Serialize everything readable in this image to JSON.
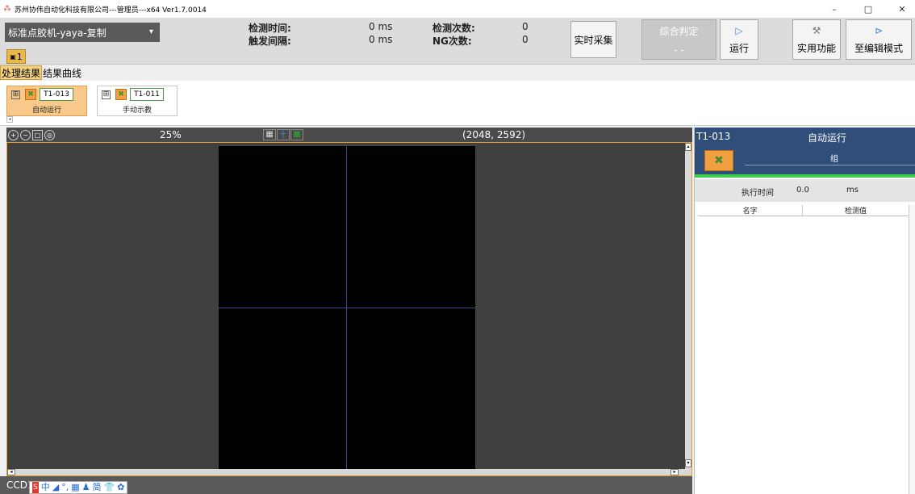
{
  "window": {
    "title": "苏州协伟自动化科技有限公司---管理员---x64 Ver1.7.0014",
    "minimize": "–",
    "maximize": "□",
    "close": "✕"
  },
  "toolbar": {
    "preset": "标准点胶机-yaya-复制",
    "camera_tab": "1",
    "stats": {
      "detect_time_label": "检测时间:",
      "detect_time_value": "0 ms",
      "trigger_interval_label": "触发间隔:",
      "trigger_interval_value": "0 ms",
      "detect_count_label": "检测次数:",
      "detect_count_value": "0",
      "ng_count_label": "NG次数:",
      "ng_count_value": "0"
    },
    "realtime_button": "实时采集",
    "judge_title": "综合判定",
    "judge_value": "- -",
    "run_button": "运行",
    "utility_button": "实用功能",
    "edit_mode_button": "至编辑模式"
  },
  "tabs": [
    {
      "label": "处理结果",
      "active": true
    },
    {
      "label": "结果曲线",
      "active": false
    }
  ],
  "programs": [
    {
      "code": "T1-013",
      "name": "自动运行",
      "active": true
    },
    {
      "code": "T1-011",
      "name": "手动示教",
      "active": false
    }
  ],
  "viewer": {
    "zoom": "25%",
    "image_size": "(2048, 2592)",
    "camera_label": "CCD1"
  },
  "ime_bar": [
    "S",
    "中",
    "◢",
    "°,",
    "▦",
    "♟",
    "简",
    "👕",
    "✿"
  ],
  "result_panel": {
    "code": "T1-013",
    "mode": "自动运行",
    "group": "组",
    "exec_time_label": "执行时间",
    "exec_time_value": "0.0",
    "exec_time_unit": "ms",
    "columns": [
      "名字",
      "检测值"
    ]
  },
  "colors": {
    "title_bg": "#ffffff",
    "toolbar_bg": "#dcdcdc",
    "viewer_bg": "#404040",
    "viewer_border": "#e49b2e",
    "panel_header": "#2f4f7a",
    "status_green": "#3ad04a",
    "accent_orange": "#f0a040"
  }
}
